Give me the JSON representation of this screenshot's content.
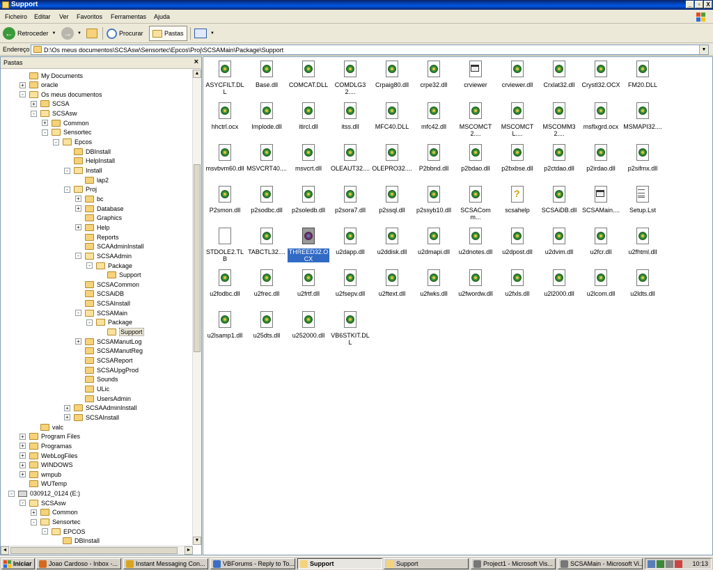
{
  "window": {
    "title": "Support",
    "buttons": [
      "_",
      "▫",
      "X"
    ]
  },
  "menu": [
    "Ficheiro",
    "Editar",
    "Ver",
    "Favoritos",
    "Ferramentas",
    "Ajuda"
  ],
  "toolbar": {
    "back_label": "Retroceder",
    "search_label": "Procurar",
    "folders_label": "Pastas"
  },
  "address": {
    "label": "Endereço",
    "path": "D:\\Os meus documentos\\SCSAsw\\Sensortec\\Epcos\\Proj\\SCSAMain\\Package\\Support"
  },
  "folders_pane": {
    "title": "Pastas",
    "close": "×",
    "tree": [
      {
        "label": "My Documents",
        "level": 2,
        "exp": ""
      },
      {
        "label": "oracle",
        "level": 2,
        "exp": "+"
      },
      {
        "label": "Os meus documentos",
        "level": 2,
        "exp": "-"
      },
      {
        "label": "SCSA",
        "level": 3,
        "exp": "+"
      },
      {
        "label": "SCSAsw",
        "level": 3,
        "exp": "-"
      },
      {
        "label": "Common",
        "level": 4,
        "exp": "+"
      },
      {
        "label": "Sensortec",
        "level": 4,
        "exp": "-"
      },
      {
        "label": "Epcos",
        "level": 5,
        "exp": "-"
      },
      {
        "label": "DBInstall",
        "level": 6,
        "exp": ""
      },
      {
        "label": "HelpInstall",
        "level": 6,
        "exp": ""
      },
      {
        "label": "Install",
        "level": 6,
        "exp": "-"
      },
      {
        "label": "lap2",
        "level": 7,
        "exp": ""
      },
      {
        "label": "Proj",
        "level": 6,
        "exp": "-"
      },
      {
        "label": "bc",
        "level": 7,
        "exp": "+"
      },
      {
        "label": "Database",
        "level": 7,
        "exp": "+"
      },
      {
        "label": "Graphics",
        "level": 7,
        "exp": ""
      },
      {
        "label": "Help",
        "level": 7,
        "exp": "+"
      },
      {
        "label": "Reports",
        "level": 7,
        "exp": ""
      },
      {
        "label": "SCAAdminInstall",
        "level": 7,
        "exp": ""
      },
      {
        "label": "SCSAAdmin",
        "level": 7,
        "exp": "-"
      },
      {
        "label": "Package",
        "level": 8,
        "exp": "-"
      },
      {
        "label": "Support",
        "level": 9,
        "exp": ""
      },
      {
        "label": "SCSACommon",
        "level": 7,
        "exp": ""
      },
      {
        "label": "SCSAiDB",
        "level": 7,
        "exp": ""
      },
      {
        "label": "SCSAInstall",
        "level": 7,
        "exp": ""
      },
      {
        "label": "SCSAMain",
        "level": 7,
        "exp": "-"
      },
      {
        "label": "Package",
        "level": 8,
        "exp": "-"
      },
      {
        "label": "Support",
        "level": 9,
        "exp": "",
        "selected": true
      },
      {
        "label": "SCSAManutLog",
        "level": 7,
        "exp": "+"
      },
      {
        "label": "SCSAManutReg",
        "level": 7,
        "exp": ""
      },
      {
        "label": "SCSAReport",
        "level": 7,
        "exp": ""
      },
      {
        "label": "SCSAUpgProd",
        "level": 7,
        "exp": ""
      },
      {
        "label": "Sounds",
        "level": 7,
        "exp": ""
      },
      {
        "label": "ULic",
        "level": 7,
        "exp": ""
      },
      {
        "label": "UsersAdmin",
        "level": 7,
        "exp": ""
      },
      {
        "label": "SCSAAdminInstall",
        "level": 6,
        "exp": "+"
      },
      {
        "label": "SCSAInstall",
        "level": 6,
        "exp": "+"
      },
      {
        "label": "valc",
        "level": 3,
        "exp": ""
      },
      {
        "label": "Program Files",
        "level": 2,
        "exp": "+"
      },
      {
        "label": "Programas",
        "level": 2,
        "exp": "+"
      },
      {
        "label": "WebLogFiles",
        "level": 2,
        "exp": "+"
      },
      {
        "label": "WINDOWS",
        "level": 2,
        "exp": "+"
      },
      {
        "label": "wmpub",
        "level": 2,
        "exp": "+"
      },
      {
        "label": "WUTemp",
        "level": 2,
        "exp": ""
      },
      {
        "label": "030912_0124 (E:)",
        "level": 1,
        "exp": "-",
        "drive": true
      },
      {
        "label": "SCSAsw",
        "level": 2,
        "exp": "-"
      },
      {
        "label": "Common",
        "level": 3,
        "exp": "+"
      },
      {
        "label": "Sensortec",
        "level": 3,
        "exp": "-"
      },
      {
        "label": "EPCOS",
        "level": 4,
        "exp": "-"
      },
      {
        "label": "DBInstall",
        "level": 5,
        "exp": ""
      }
    ]
  },
  "files": [
    {
      "name": "ASYCFILT.DLL",
      "icon": "dll"
    },
    {
      "name": "Base.dll",
      "icon": "dll"
    },
    {
      "name": "COMCAT.DLL",
      "icon": "dll"
    },
    {
      "name": "COMDLG32....",
      "icon": "dll"
    },
    {
      "name": "Crpaig80.dll",
      "icon": "dll"
    },
    {
      "name": "crpe32.dll",
      "icon": "dll"
    },
    {
      "name": "crviewer",
      "icon": "exe"
    },
    {
      "name": "crviewer.dll",
      "icon": "dll"
    },
    {
      "name": "Crxlat32.dll",
      "icon": "dll"
    },
    {
      "name": "Crystl32.OCX",
      "icon": "dll"
    },
    {
      "name": "FM20.DLL",
      "icon": "dll"
    },
    {
      "name": "hhctrl.ocx",
      "icon": "dll"
    },
    {
      "name": "Implode.dll",
      "icon": "dll"
    },
    {
      "name": "itircl.dll",
      "icon": "dll"
    },
    {
      "name": "itss.dll",
      "icon": "dll"
    },
    {
      "name": "MFC40.DLL",
      "icon": "dll"
    },
    {
      "name": "mfc42.dll",
      "icon": "dll"
    },
    {
      "name": "MSCOMCT2....",
      "icon": "dll"
    },
    {
      "name": "MSCOMCTL....",
      "icon": "dll"
    },
    {
      "name": "MSCOMM32....",
      "icon": "dll"
    },
    {
      "name": "msflxgrd.ocx",
      "icon": "dll"
    },
    {
      "name": "MSMAPI32....",
      "icon": "dll"
    },
    {
      "name": "msvbvm60.dll",
      "icon": "dll"
    },
    {
      "name": "MSVCRT40....",
      "icon": "dll"
    },
    {
      "name": "msvcrt.dll",
      "icon": "dll"
    },
    {
      "name": "OLEAUT32....",
      "icon": "dll"
    },
    {
      "name": "OLEPRO32....",
      "icon": "dll"
    },
    {
      "name": "P2bbnd.dll",
      "icon": "dll"
    },
    {
      "name": "p2bdao.dll",
      "icon": "dll"
    },
    {
      "name": "p2bxbse.dll",
      "icon": "dll"
    },
    {
      "name": "p2ctdao.dll",
      "icon": "dll"
    },
    {
      "name": "p2irdao.dll",
      "icon": "dll"
    },
    {
      "name": "p2sifmx.dll",
      "icon": "dll"
    },
    {
      "name": "P2smon.dll",
      "icon": "dll"
    },
    {
      "name": "p2sodbc.dll",
      "icon": "dll"
    },
    {
      "name": "p2soledb.dll",
      "icon": "dll"
    },
    {
      "name": "p2sora7.dll",
      "icon": "dll"
    },
    {
      "name": "p2ssql.dll",
      "icon": "dll"
    },
    {
      "name": "p2ssyb10.dll",
      "icon": "dll"
    },
    {
      "name": "SCSAComm...",
      "icon": "dll"
    },
    {
      "name": "scsahelp",
      "icon": "help"
    },
    {
      "name": "SCSAiDB.dll",
      "icon": "dll"
    },
    {
      "name": "SCSAMain....",
      "icon": "exe"
    },
    {
      "name": "Setup.Lst",
      "icon": "txt"
    },
    {
      "name": "STDOLE2.TLB",
      "icon": "blank"
    },
    {
      "name": "TABCTL32....",
      "icon": "dll"
    },
    {
      "name": "THREED32.OCX",
      "icon": "dll",
      "selected": true
    },
    {
      "name": "u2dapp.dll",
      "icon": "dll"
    },
    {
      "name": "u2ddisk.dll",
      "icon": "dll"
    },
    {
      "name": "u2dmapi.dll",
      "icon": "dll"
    },
    {
      "name": "u2dnotes.dll",
      "icon": "dll"
    },
    {
      "name": "u2dpost.dll",
      "icon": "dll"
    },
    {
      "name": "u2dvim.dll",
      "icon": "dll"
    },
    {
      "name": "u2fcr.dll",
      "icon": "dll"
    },
    {
      "name": "u2fhtml.dll",
      "icon": "dll"
    },
    {
      "name": "u2fodbc.dll",
      "icon": "dll"
    },
    {
      "name": "u2frec.dll",
      "icon": "dll"
    },
    {
      "name": "u2frtf.dll",
      "icon": "dll"
    },
    {
      "name": "u2fsepv.dll",
      "icon": "dll"
    },
    {
      "name": "u2ftext.dll",
      "icon": "dll"
    },
    {
      "name": "u2fwks.dll",
      "icon": "dll"
    },
    {
      "name": "u2fwordw.dll",
      "icon": "dll"
    },
    {
      "name": "u2fxls.dll",
      "icon": "dll"
    },
    {
      "name": "u2l2000.dll",
      "icon": "dll"
    },
    {
      "name": "u2lcom.dll",
      "icon": "dll"
    },
    {
      "name": "u2ldts.dll",
      "icon": "dll"
    },
    {
      "name": "u2lsamp1.dll",
      "icon": "dll"
    },
    {
      "name": "u25dts.dll",
      "icon": "dll"
    },
    {
      "name": "u252000.dll",
      "icon": "dll"
    },
    {
      "name": "VB6STKIT.DLL",
      "icon": "dll"
    }
  ],
  "taskbar": {
    "start_label": "Iniciar",
    "tasks": [
      {
        "label": "Joao Cardoso - Inbox -...",
        "color": "#d46a1e"
      },
      {
        "label": "Instant Messaging Con...",
        "color": "#d9a520"
      },
      {
        "label": "VBForums - Reply to To...",
        "color": "#3a6fc4"
      },
      {
        "label": "Support",
        "color": "#f6d27a",
        "active": true
      },
      {
        "label": "Support",
        "color": "#f6d27a"
      },
      {
        "label": "Project1 - Microsoft Vis...",
        "color": "#777777"
      },
      {
        "label": "SCSAMain - Microsoft Vi...",
        "color": "#777777"
      }
    ],
    "clock": "10:13"
  }
}
